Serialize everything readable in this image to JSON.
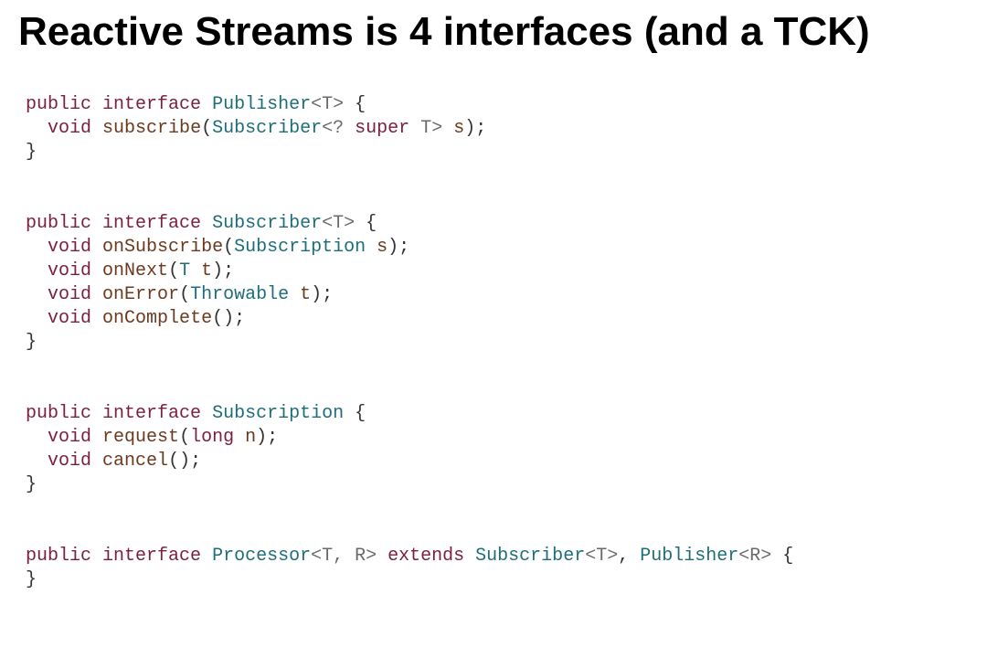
{
  "title": "Reactive Streams is 4 interfaces (and a TCK)",
  "colors": {
    "keyword": "#7a1f3d",
    "type": "#1e6e7a",
    "method": "#6b3a1e",
    "param": "#6b3a1e",
    "generic": "#6a6a6a",
    "punct": "#333333"
  },
  "code": {
    "publisher": {
      "line1": {
        "public": "public",
        "interface": "interface",
        "name": "Publisher",
        "generic": "<T>",
        "open": " {"
      },
      "line2": {
        "indent": "  ",
        "void": "void",
        "method": "subscribe",
        "open": "(",
        "type": "Subscriber",
        "generic_open": "<?",
        "super": "super",
        "t": "T",
        "generic_close": ">",
        "param": "s",
        "close": ");"
      },
      "line3": {
        "close": "}"
      }
    },
    "subscriber": {
      "line1": {
        "public": "public",
        "interface": "interface",
        "name": "Subscriber",
        "generic": "<T>",
        "open": " {"
      },
      "line2": {
        "indent": "  ",
        "void": "void",
        "method": "onSubscribe",
        "open": "(",
        "type": "Subscription",
        "param": "s",
        "close": ");"
      },
      "line3": {
        "indent": "  ",
        "void": "void",
        "method": "onNext",
        "open": "(",
        "type": "T",
        "param": "t",
        "close": ");"
      },
      "line4": {
        "indent": "  ",
        "void": "void",
        "method": "onError",
        "open": "(",
        "type": "Throwable",
        "param": "t",
        "close": ");"
      },
      "line5": {
        "indent": "  ",
        "void": "void",
        "method": "onComplete",
        "open": "(",
        "close": ");"
      },
      "line6": {
        "close": "}"
      }
    },
    "subscription": {
      "line1": {
        "public": "public",
        "interface": "interface",
        "name": "Subscription",
        "open": " {"
      },
      "line2": {
        "indent": "  ",
        "void": "void",
        "method": "request",
        "open": "(",
        "type": "long",
        "param": "n",
        "close": ");"
      },
      "line3": {
        "indent": "  ",
        "void": "void",
        "method": "cancel",
        "open": "(",
        "close": ");"
      },
      "line4": {
        "close": "}"
      }
    },
    "processor": {
      "line1": {
        "public": "public",
        "interface": "interface",
        "name": "Processor",
        "generic": "<T, R>",
        "extends": "extends",
        "type1": "Subscriber",
        "generic1": "<T>",
        "comma": ", ",
        "type2": "Publisher",
        "generic2": "<R>",
        "open": " {"
      },
      "line2": {
        "close": "}"
      }
    }
  }
}
